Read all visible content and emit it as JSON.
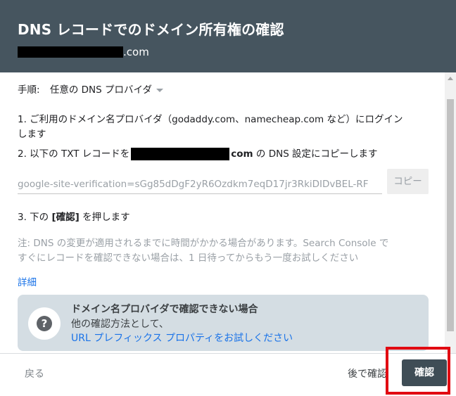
{
  "header": {
    "title": "DNS レコードでのドメイン所有権の確認",
    "domain_suffix": ".com"
  },
  "procedure": {
    "label": "手順:",
    "selected": "任意の DNS プロバイダ"
  },
  "steps": {
    "step1_line1": "1. ご利用のドメイン名プロバイダ（godaddy.com、namecheap.com など）にログイン",
    "step1_line2": "します",
    "step2_prefix": "2. 以下の TXT レコードを",
    "step2_domain_suffix": "com",
    "step2_suffix": " の DNS 設定にコピーします",
    "step3_prefix": "3. 下の ",
    "step3_bold": "[確認]",
    "step3_suffix": " を押します"
  },
  "txt_record": {
    "value": "google-site-verification=sGg85dDgF2yR6Ozdkm7eqD17jr3RkiDIDvBEL-RF",
    "copy_label": "コピー"
  },
  "note": {
    "line1": "注: DNS の変更が適用されるまでに時間がかかる場合があります。Search Console で",
    "line2": "すぐにレコードを確認できない場合は、1 日待ってからもう一度お試しください"
  },
  "details_link": "詳細",
  "help_card": {
    "icon_glyph": "?",
    "title": "ドメイン名プロバイダで確認できない場合",
    "body": "他の確認方法として、",
    "link": "URL プレフィックス プロパティをお試しください"
  },
  "footer": {
    "back_label": "戻る",
    "later_label": "後で確認",
    "confirm_label": "確認"
  },
  "colors": {
    "header_bg": "#46555f",
    "link": "#1a73e8",
    "confirm_bg": "#3f4d56",
    "highlight": "#e10a12",
    "card_bg": "#d4dde3"
  }
}
